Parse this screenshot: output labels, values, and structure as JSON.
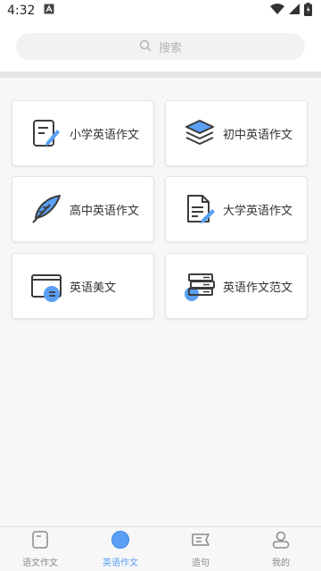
{
  "status_bar": {
    "time": "4:32",
    "icons": [
      "notification-a-icon",
      "wifi-icon",
      "signal-icon",
      "battery-icon"
    ]
  },
  "search": {
    "placeholder": "搜索",
    "icon": "search-icon"
  },
  "categories": [
    {
      "label": "小学英语作文",
      "icon": "pencil-note-icon"
    },
    {
      "label": "初中英语作文",
      "icon": "layers-icon"
    },
    {
      "label": "高中英语作文",
      "icon": "feather-quill-icon"
    },
    {
      "label": "大学英语作文",
      "icon": "document-pen-icon"
    },
    {
      "label": "英语美文",
      "icon": "book-window-icon"
    },
    {
      "label": "英语作文范文",
      "icon": "stacked-books-icon"
    }
  ],
  "bottom_nav": {
    "items": [
      {
        "label": "语文作文",
        "icon": "notebook-icon",
        "active": false
      },
      {
        "label": "英语作文",
        "icon": "circle-icon",
        "active": true
      },
      {
        "label": "造句",
        "icon": "sentence-card-icon",
        "active": false
      },
      {
        "label": "我的",
        "icon": "user-icon",
        "active": false
      }
    ]
  },
  "colors": {
    "accent": "#5a9ff4",
    "icon_dark": "#3c3c3c",
    "card_bg": "#ffffff",
    "content_bg": "#f7f7f7",
    "search_bg": "#f2f2f2"
  }
}
